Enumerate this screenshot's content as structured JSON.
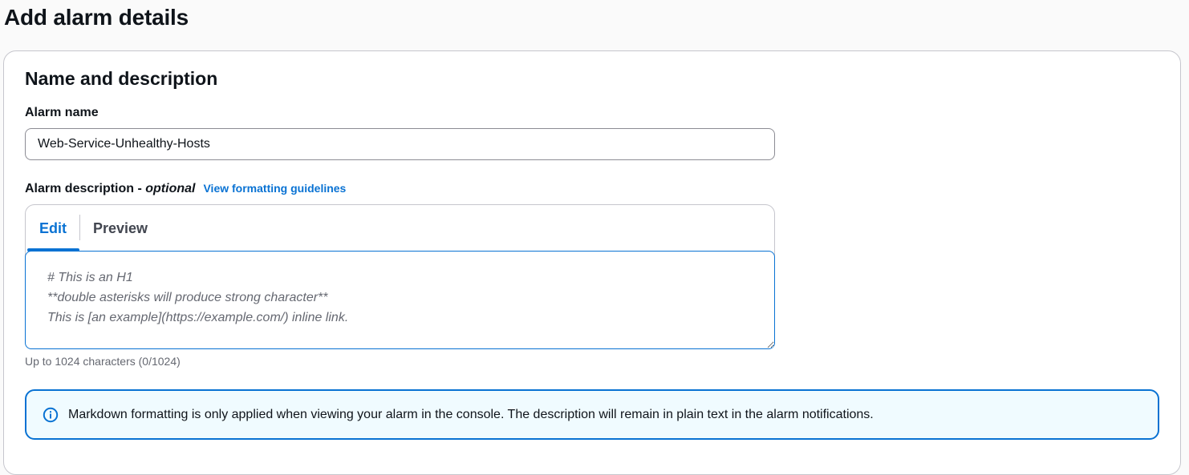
{
  "page": {
    "title": "Add alarm details"
  },
  "section": {
    "title": "Name and description"
  },
  "alarm_name": {
    "label": "Alarm name",
    "value": "Web-Service-Unhealthy-Hosts"
  },
  "alarm_description": {
    "label": "Alarm description - ",
    "optional": "optional",
    "link": "View formatting guidelines",
    "tabs": [
      {
        "label": "Edit",
        "active": true
      },
      {
        "label": "Preview",
        "active": false
      }
    ],
    "placeholder": "# This is an H1\n**double asterisks will produce strong character**\nThis is [an example](https://example.com/) inline link.",
    "value": "",
    "constraint": "Up to 1024 characters (0/1024)"
  },
  "info_alert": {
    "icon": "info-icon",
    "text": "Markdown formatting is only applied when viewing your alarm in the console. The description will remain in plain text in the alarm notifications."
  },
  "colors": {
    "accent": "#0972d3",
    "alert_bg": "#f0fbff",
    "border": "#c6c6cd",
    "text": "#0f141a",
    "muted": "#656871"
  }
}
